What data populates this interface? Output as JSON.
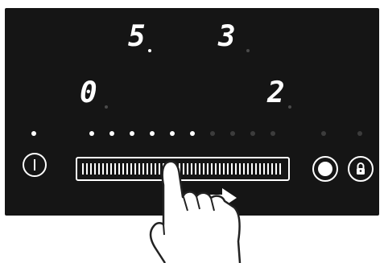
{
  "zones": {
    "rear_left": {
      "value": "5",
      "dot": true
    },
    "rear_right": {
      "value": "3",
      "dot": false
    },
    "front_left": {
      "value": "0",
      "dot": false
    },
    "front_right": {
      "value": "2",
      "dot": false
    }
  },
  "power_level": {
    "lit": 6,
    "total": 10
  },
  "slider": {
    "level": 0.5
  },
  "gesture": "swipe-right",
  "icons": {
    "power": "power-icon",
    "timer": "timer-icon",
    "lock": "lock-icon",
    "arrow": "arrow-right-icon",
    "hand": "hand-pointer-icon"
  },
  "colors": {
    "panel": "#151515",
    "display": "#ffffff",
    "inactive": "#3c3c3c"
  }
}
